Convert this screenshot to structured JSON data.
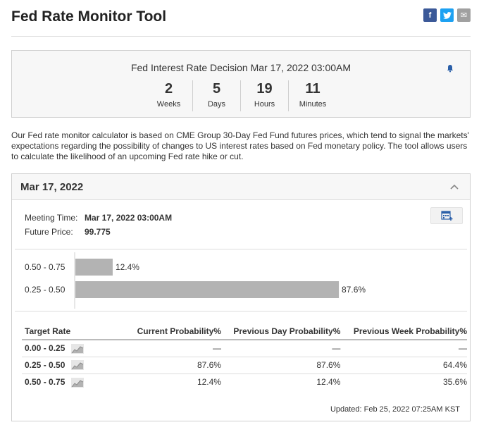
{
  "page": {
    "title": "Fed Rate Monitor Tool",
    "share": {
      "facebook": "f",
      "twitter": "t",
      "email": "✉"
    }
  },
  "countdown": {
    "event": "Fed Interest Rate Decision Mar 17, 2022 03:00AM",
    "units": [
      {
        "value": "2",
        "label": "Weeks"
      },
      {
        "value": "5",
        "label": "Days"
      },
      {
        "value": "19",
        "label": "Hours"
      },
      {
        "value": "11",
        "label": "Minutes"
      }
    ]
  },
  "description": "Our Fed rate monitor calculator is based on CME Group 30-Day Fed Fund futures prices, which tend to signal the markets' expectations regarding the possibility of changes to US interest rates based on Fed monetary policy. The tool allows users to calculate the likelihood of an upcoming Fed rate hike or cut.",
  "meeting": {
    "date": "Mar 17, 2022",
    "time_label": "Meeting Time:",
    "time_value": "Mar 17, 2022 03:00AM",
    "price_label": "Future Price:",
    "price_value": "99.775"
  },
  "chart_data": {
    "type": "bar",
    "orientation": "horizontal",
    "categories": [
      "0.50 - 0.75",
      "0.25 - 0.50"
    ],
    "values": [
      12.4,
      87.6
    ],
    "value_labels": [
      "12.4%",
      "87.6%"
    ],
    "xlim": [
      0,
      100
    ],
    "bar_color": "#b3b3b3"
  },
  "table": {
    "headers": [
      "Target Rate",
      "Current Probability%",
      "Previous Day Probability%",
      "Previous Week Probability%"
    ],
    "rows": [
      {
        "rate": "0.00 - 0.25",
        "current": "—",
        "prev_day": "—",
        "prev_week": "—"
      },
      {
        "rate": "0.25 - 0.50",
        "current": "87.6%",
        "prev_day": "87.6%",
        "prev_week": "64.4%"
      },
      {
        "rate": "0.50 - 0.75",
        "current": "12.4%",
        "prev_day": "12.4%",
        "prev_week": "35.6%"
      }
    ]
  },
  "updated": "Updated: Feb 25, 2022 07:25AM KST",
  "icons": {
    "bell": "bell-icon",
    "chevron": "chevron-up-icon",
    "calendar": "calendar-add-icon",
    "sparkline": "sparkline-chart-icon"
  }
}
